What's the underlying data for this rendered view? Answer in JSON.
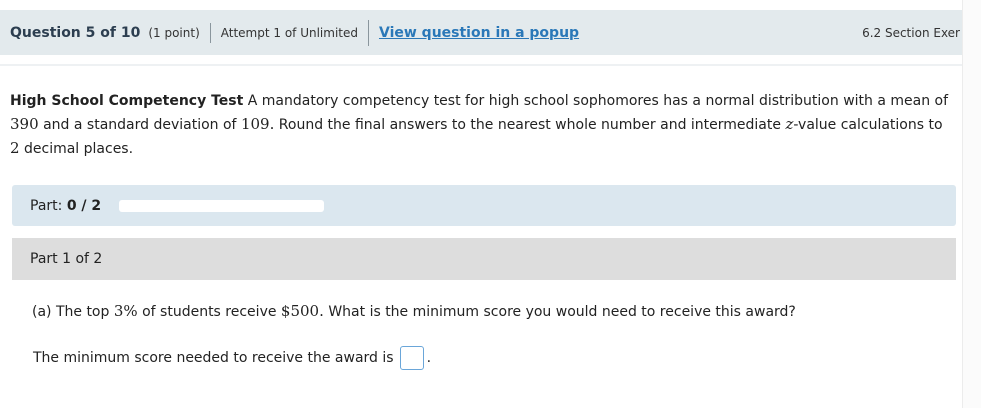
{
  "header": {
    "question_title": "Question 5 of 10",
    "points": "(1 point)",
    "attempt": "Attempt 1 of Unlimited",
    "popup_link": "View question in a popup",
    "section": "6.2 Section Exer"
  },
  "intro": {
    "title": "High School Competency Test",
    "text_1": "A mandatory competency test for high school sophomores has a normal distribution with a mean of",
    "mean": "390",
    "text_2": "and a standard deviation of",
    "sd": "109.",
    "text_3": "Round the final answers to the nearest whole number and intermediate",
    "z": "z",
    "text_4": "-value calculations to",
    "decimals": "2",
    "text_5": "decimal places."
  },
  "progress": {
    "label": "Part:",
    "value": "0 / 2",
    "fraction": 0
  },
  "part": {
    "header": "Part 1 of 2",
    "q_prefix": "(a) The top",
    "q_pct": "3%",
    "q_mid": "of students receive",
    "q_amount": "$500.",
    "q_suffix": "What is the minimum score you would need to receive this award?",
    "answer_text": "The minimum score needed to receive the award is",
    "answer_value": "",
    "answer_period": "."
  }
}
